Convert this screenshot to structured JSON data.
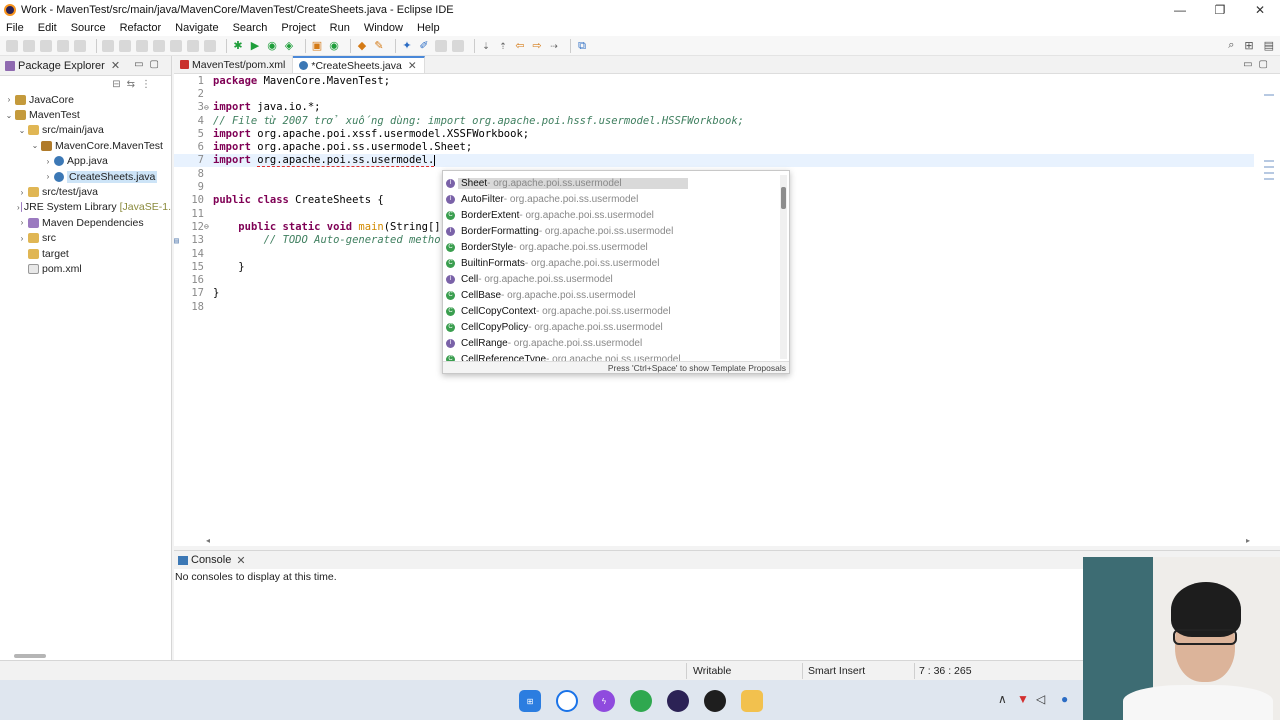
{
  "window": {
    "title": "Work - MavenTest/src/main/java/MavenCore/MavenTest/CreateSheets.java - Eclipse IDE",
    "controls": [
      "—",
      "❐",
      "✕"
    ]
  },
  "menu": [
    "File",
    "Edit",
    "Source",
    "Refactor",
    "Navigate",
    "Search",
    "Project",
    "Run",
    "Window",
    "Help"
  ],
  "package_explorer": {
    "title": "Package Explorer",
    "close": "✕",
    "tree": [
      {
        "label": "JavaCore",
        "arrow": "›",
        "icon": "proj",
        "indent": 0
      },
      {
        "label": "MavenTest",
        "arrow": "⌄",
        "icon": "proj",
        "indent": 0
      },
      {
        "label": "src/main/java",
        "arrow": "⌄",
        "icon": "folder",
        "indent": 1
      },
      {
        "label": "MavenCore.MavenTest",
        "arrow": "⌄",
        "icon": "pkgi",
        "indent": 2
      },
      {
        "label": "App.java",
        "arrow": "›",
        "icon": "java",
        "indent": 3
      },
      {
        "label": "CreateSheets.java",
        "arrow": "›",
        "icon": "java",
        "indent": 3,
        "selected": true
      },
      {
        "label": "src/test/java",
        "arrow": "›",
        "icon": "folder",
        "indent": 1
      },
      {
        "label": "JRE System Library",
        "decor": "[JavaSE-1.",
        "arrow": "›",
        "icon": "lib",
        "indent": 1
      },
      {
        "label": "Maven Dependencies",
        "arrow": "›",
        "icon": "lib",
        "indent": 1
      },
      {
        "label": "src",
        "arrow": "›",
        "icon": "folder",
        "indent": 1
      },
      {
        "label": "target",
        "arrow": "",
        "icon": "folder",
        "indent": 1
      },
      {
        "label": "pom.xml",
        "arrow": "",
        "icon": "xml",
        "indent": 1
      }
    ]
  },
  "editor": {
    "tabs": [
      {
        "label": "MavenTest/pom.xml",
        "active": false
      },
      {
        "label": "*CreateSheets.java",
        "active": true,
        "close": "✕"
      }
    ],
    "lines": [
      {
        "n": "1",
        "parts": [
          [
            "kw",
            "package"
          ],
          [
            "src",
            " MavenCore.MavenTest;"
          ]
        ]
      },
      {
        "n": "2",
        "parts": []
      },
      {
        "n": "3",
        "marker": "fold",
        "parts": [
          [
            "kw",
            "import"
          ],
          [
            "src",
            " java.io.*;"
          ]
        ]
      },
      {
        "n": "4",
        "parts": [
          [
            "cm",
            "// File từ 2007 trở xuống dùng: import org.apache.poi.hssf.usermodel.HSSFWorkbook;"
          ]
        ]
      },
      {
        "n": "5",
        "parts": [
          [
            "kw",
            "import"
          ],
          [
            "src",
            " org.apache.poi.xssf.usermodel.XSSFWorkbook;"
          ]
        ]
      },
      {
        "n": "6",
        "parts": [
          [
            "kw",
            "import"
          ],
          [
            "src",
            " org.apache.poi.ss.usermodel.Sheet;"
          ]
        ]
      },
      {
        "n": "7",
        "marker": "error",
        "current": true,
        "parts": [
          [
            "kw",
            "import"
          ],
          [
            "src",
            " "
          ],
          [
            "err",
            "org.apache.poi.ss.usermodel."
          ]
        ],
        "caret": true
      },
      {
        "n": "8",
        "parts": []
      },
      {
        "n": "9",
        "parts": []
      },
      {
        "n": "10",
        "parts": [
          [
            "kw",
            "public class"
          ],
          [
            "src",
            " CreateSheets {"
          ]
        ]
      },
      {
        "n": "11",
        "parts": []
      },
      {
        "n": "12",
        "marker": "fold",
        "parts": [
          [
            "src",
            "    "
          ],
          [
            "kw",
            "public static void"
          ],
          [
            "src",
            " "
          ],
          [
            "fn",
            "main"
          ],
          [
            "src",
            "(String[]"
          ]
        ]
      },
      {
        "n": "13",
        "marker": "task",
        "parts": [
          [
            "cm",
            "        // TODO Auto-generated metho"
          ]
        ]
      },
      {
        "n": "14",
        "parts": []
      },
      {
        "n": "15",
        "parts": [
          [
            "src",
            "    }"
          ]
        ]
      },
      {
        "n": "16",
        "parts": []
      },
      {
        "n": "17",
        "parts": [
          [
            "src",
            "}"
          ]
        ]
      },
      {
        "n": "18",
        "parts": []
      }
    ]
  },
  "content_assist": {
    "proposals": [
      {
        "name": "Sheet",
        "pkg": " - org.apache.poi.ss.usermodel",
        "kind": "iface",
        "selected": true
      },
      {
        "name": "AutoFilter",
        "pkg": " - org.apache.poi.ss.usermodel",
        "kind": "iface"
      },
      {
        "name": "BorderExtent",
        "pkg": " - org.apache.poi.ss.usermodel",
        "kind": "cls"
      },
      {
        "name": "BorderFormatting",
        "pkg": " - org.apache.poi.ss.usermodel",
        "kind": "iface"
      },
      {
        "name": "BorderStyle",
        "pkg": " - org.apache.poi.ss.usermodel",
        "kind": "cls"
      },
      {
        "name": "BuiltinFormats",
        "pkg": " - org.apache.poi.ss.usermodel",
        "kind": "cls"
      },
      {
        "name": "Cell",
        "pkg": " - org.apache.poi.ss.usermodel",
        "kind": "iface"
      },
      {
        "name": "CellBase",
        "pkg": " - org.apache.poi.ss.usermodel",
        "kind": "cls"
      },
      {
        "name": "CellCopyContext",
        "pkg": " - org.apache.poi.ss.usermodel",
        "kind": "cls"
      },
      {
        "name": "CellCopyPolicy",
        "pkg": " - org.apache.poi.ss.usermodel",
        "kind": "cls"
      },
      {
        "name": "CellRange",
        "pkg": " - org.apache.poi.ss.usermodel",
        "kind": "iface"
      },
      {
        "name": "CellReferenceType",
        "pkg": " - org.apache.poi.ss.usermodel",
        "kind": "cls"
      }
    ],
    "footer": "Press 'Ctrl+Space' to show Template Proposals"
  },
  "console": {
    "title": "Console",
    "close": "✕",
    "message": "No consoles to display at this time."
  },
  "status": {
    "writable": "Writable",
    "insert_mode": "Smart Insert",
    "position": "7 : 36 : 265"
  },
  "colors": {
    "keyword": "#7f0055",
    "comment": "#3f7f5f",
    "method": "#d28a00",
    "error": "#e03030",
    "selection": "#cde4f7"
  }
}
